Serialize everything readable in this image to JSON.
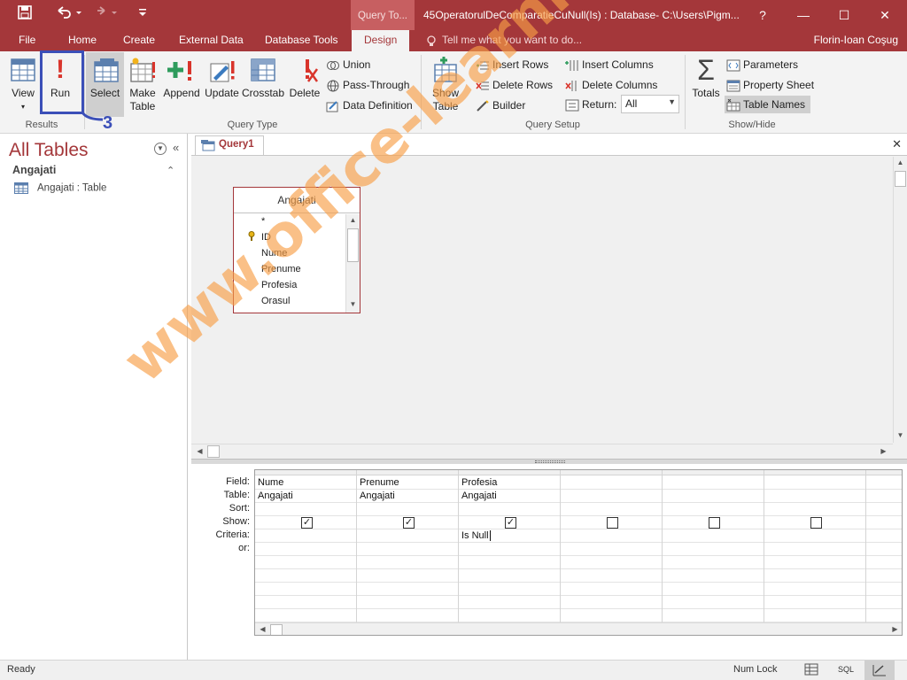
{
  "titlebar": {
    "contextual_tab": "Query To...",
    "doc_title": "45OperatorulDeComparatieCuNull(Is) : Database- C:\\Users\\Pigm...",
    "help": "?",
    "minimize": "—",
    "maximize": "☐",
    "close": "✕"
  },
  "qat": {
    "save_icon": "save-icon",
    "undo_icon": "undo-icon",
    "redo_icon": "redo-icon",
    "customize_icon": "customize-icon"
  },
  "tabs": [
    "File",
    "Home",
    "Create",
    "External Data",
    "Database Tools",
    "Design"
  ],
  "tellme": "Tell me what you want to do...",
  "user": "Florin-Ioan Coşug",
  "ribbon": {
    "results": {
      "view": "View",
      "run": "Run",
      "label": "Results"
    },
    "query_type": {
      "select": "Select",
      "make_table_1": "Make",
      "make_table_2": "Table",
      "append": "Append",
      "update": "Update",
      "crosstab": "Crosstab",
      "delete": "Delete",
      "union": "Union",
      "pass_through": "Pass-Through",
      "data_definition": "Data Definition",
      "label": "Query Type"
    },
    "query_setup": {
      "show_table_1": "Show",
      "show_table_2": "Table",
      "insert_rows": "Insert Rows",
      "delete_rows": "Delete Rows",
      "builder": "Builder",
      "insert_columns": "Insert Columns",
      "delete_columns": "Delete Columns",
      "return_label": "Return:",
      "return_value": "All",
      "label": "Query Setup"
    },
    "show_hide": {
      "totals": "Totals",
      "parameters": "Parameters",
      "property_sheet": "Property Sheet",
      "table_names": "Table Names",
      "label": "Show/Hide"
    }
  },
  "nav": {
    "title": "All Tables",
    "group": "Angajati",
    "item": "Angajati : Table"
  },
  "query": {
    "tab": "Query1",
    "table": {
      "name": "Angajati",
      "fields": [
        "*",
        "ID",
        "Nume",
        "Prenume",
        "Profesia",
        "Orasul"
      ]
    },
    "grid": {
      "row_labels": [
        "Field:",
        "Table:",
        "Sort:",
        "Show:",
        "Criteria:",
        "or:"
      ],
      "columns": [
        {
          "field": "Nume",
          "table": "Angajati",
          "show": true,
          "criteria": ""
        },
        {
          "field": "Prenume",
          "table": "Angajati",
          "show": true,
          "criteria": ""
        },
        {
          "field": "Profesia",
          "table": "Angajati",
          "show": true,
          "criteria": "Is Null"
        },
        {
          "field": "",
          "table": "",
          "show": false,
          "criteria": ""
        },
        {
          "field": "",
          "table": "",
          "show": false,
          "criteria": ""
        },
        {
          "field": "",
          "table": "",
          "show": false,
          "criteria": ""
        }
      ]
    }
  },
  "status": {
    "left": "Ready",
    "num_lock": "Num Lock",
    "sql": "SQL"
  },
  "annotation": {
    "number": "3"
  },
  "watermark": "www.office-learning.ro",
  "colors": {
    "accent": "#a4373a",
    "annotation": "#3b4fb8",
    "watermark": "#f89e46"
  }
}
